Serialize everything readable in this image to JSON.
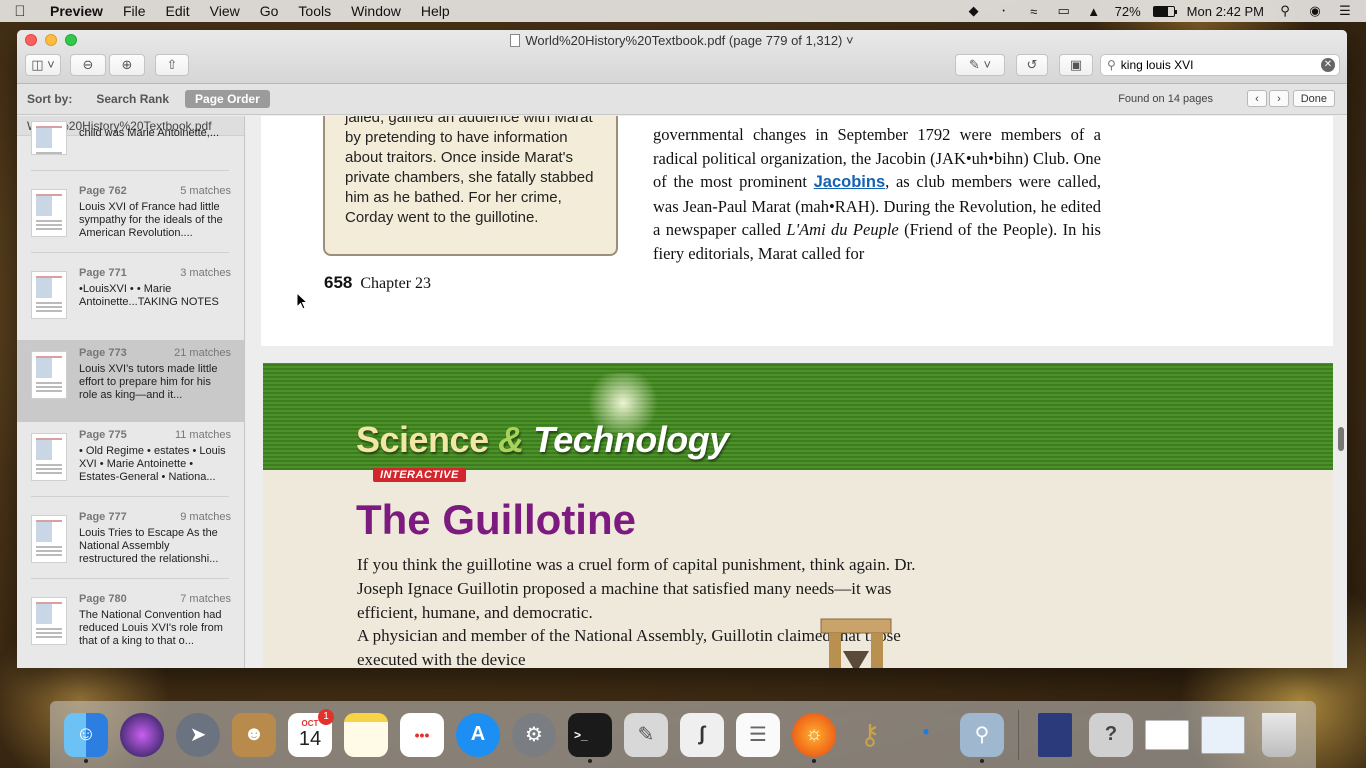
{
  "menubar": {
    "app_name": "Preview",
    "menus": [
      "File",
      "Edit",
      "View",
      "Go",
      "Tools",
      "Window",
      "Help"
    ],
    "battery_percent": "72%",
    "clock": "Mon 2:42 PM"
  },
  "window": {
    "title": "World%20History%20Textbook.pdf (page 779 of 1,312)",
    "search": {
      "value": "king louis XVI"
    }
  },
  "sortbar": {
    "label": "Sort by:",
    "options": [
      "Search Rank",
      "Page Order"
    ],
    "active": "Page Order",
    "found": "Found on 14 pages",
    "done": "Done"
  },
  "sidebar": {
    "filename": "World%20History%20Textbook.pdf",
    "partial_text": "child was Marie Antoinette,...",
    "results": [
      {
        "page": "Page 762",
        "matches": "5 matches",
        "text": "Louis XVI of France had little sympathy for the ideals of the American Revolution...."
      },
      {
        "page": "Page 771",
        "matches": "3 matches",
        "text": "•LouisXVI • • Marie Antoinette...TAKING NOTES"
      },
      {
        "page": "Page 773",
        "matches": "21 matches",
        "text": "Louis XVI's tutors made little effort to prepare him for his role as king—and it..."
      },
      {
        "page": "Page 775",
        "matches": "11 matches",
        "text": "• Old Regime • estates • Louis XVI • Marie Antoinette • Estates-General • Nationa..."
      },
      {
        "page": "Page 777",
        "matches": "9 matches",
        "text": "Louis Tries to Escape As the National Assembly restructured the relationshi..."
      },
      {
        "page": "Page 780",
        "matches": "7 matches",
        "text": "The National Convention had reduced Louis XVI's role from that of a king to that o..."
      }
    ]
  },
  "page1": {
    "box_lines": [
      "jailed, gained an audience with Marat",
      "by pretending to have information",
      "about traitors. Once inside Marat's",
      "private chambers, she fatally stabbed",
      "him as he bathed. For her crime,",
      "Corday went to the guillotine."
    ],
    "main_before_link": "governmental changes in September 1792 were members of a radical political organization, the Jacobin (JAK•uh•bihn) Club. One of the most prominent ",
    "main_link": "Jacobins",
    "main_after_link": ", as club members were called, was Jean-Paul Marat (mah•RAH). During the Revolution, he edited a newspaper called ",
    "main_italic": "L'Ami du Peuple",
    "main_end": " (Friend of the People). In his fiery editorials, Marat called for",
    "footer_num": "658",
    "footer_chapter": "Chapter 23"
  },
  "page2": {
    "banner_science": "Science",
    "banner_amp": "&",
    "banner_tech": "Technology",
    "interactive_label": "INTERACTIVE",
    "title": "The Guillotine",
    "para1": "If you think the guillotine was a cruel form of capital punishment, think again. Dr. Joseph Ignace Guillotin proposed a machine that satisfied many needs—it was efficient, humane, and democratic.",
    "para2": "A physician and member of the National Assembly, Guillotin claimed that those executed with the device"
  },
  "dock": {
    "apps": [
      "Finder",
      "Siri",
      "Launchpad",
      "Contacts",
      "Calendar",
      "Notes",
      "Reminders",
      "App Store",
      "System Preferences",
      "Terminal",
      "Script Editor",
      "Grapher",
      "TextEdit",
      "Firefox",
      "Keychain Access",
      "Bluetooth File Exchange",
      "Preview"
    ],
    "calendar_month": "OCT",
    "calendar_day": "14",
    "calendar_badge": "1",
    "right_items": [
      "World History Book",
      "Unknown",
      "Document",
      "Document",
      "Trash"
    ]
  }
}
